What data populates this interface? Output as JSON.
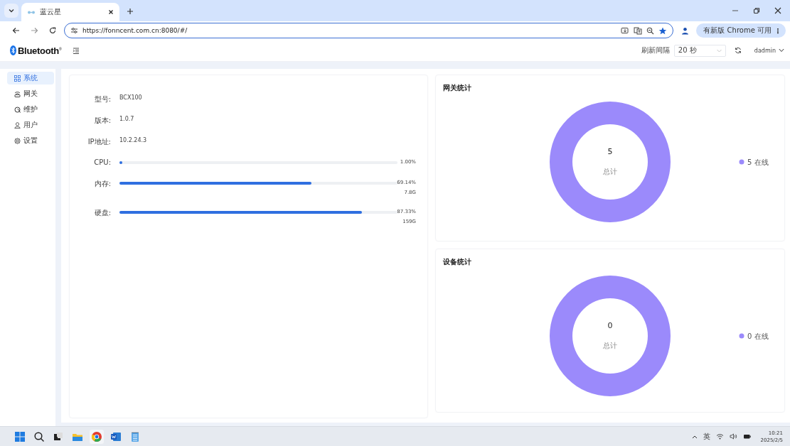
{
  "browser": {
    "tab": {
      "title": "蓝云星",
      "selected": true
    },
    "address": "https://fonncent.com.cn:8080/#/",
    "update_button": "有新版 Chrome 可用",
    "menu_glyph": "⋮"
  },
  "header": {
    "logo": "Bluetooth$^{®}$",
    "refresh_label": "刷新间隔",
    "refresh_value": "20 秒",
    "user": "dadmin"
  },
  "sidebar": {
    "items": [
      {
        "label": "系统",
        "selected": true
      },
      {
        "label": "网关",
        "selected": false
      },
      {
        "label": "维护",
        "selected": false
      },
      {
        "label": "用户",
        "selected": false
      },
      {
        "label": "设置",
        "selected": false
      }
    ]
  },
  "system_info": {
    "fields": [
      {
        "label": "型号:",
        "value": "BCX100"
      },
      {
        "label": "版本:",
        "value": "1.0.7"
      },
      {
        "label": "IP地址:",
        "value": "10.2.24.3"
      }
    ],
    "meters": [
      {
        "label": "CPU:",
        "level": 0.01,
        "reading": "1.00%"
      },
      {
        "label": "内存:",
        "level": 0.6914,
        "reading": "69.14%",
        "detail": "7.8G"
      },
      {
        "label": "硬盘:",
        "level": 0.8733,
        "reading": "87.33%",
        "detail": "159G"
      }
    ]
  },
  "charts": [
    {
      "title": "网关统计",
      "total": "5",
      "total_label": "总计",
      "legend": [
        {
          "label": "5 在线",
          "color": "#9b8afb"
        }
      ]
    },
    {
      "title": "设备统计",
      "total": "0",
      "total_label": "总计",
      "legend": [
        {
          "label": "0 在线",
          "color": "#9b8afb"
        }
      ]
    }
  ],
  "taskbar": {
    "tray_language": "英",
    "time": "10:21",
    "date": "2025/2/5"
  }
}
